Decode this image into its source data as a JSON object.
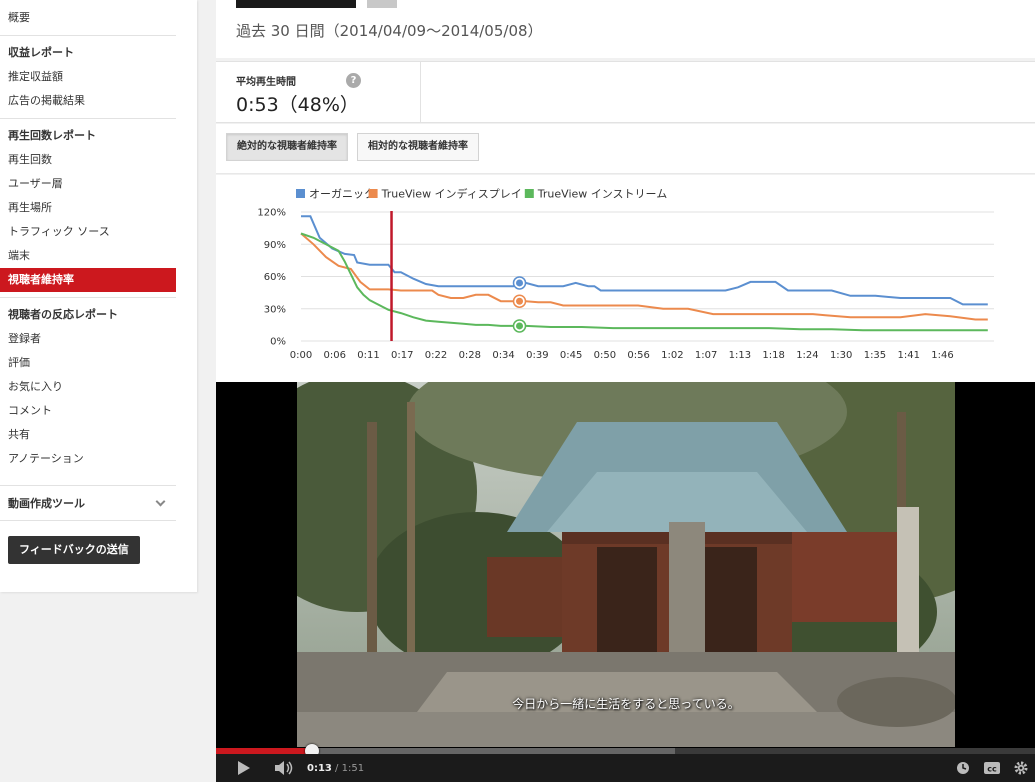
{
  "sidebar": {
    "overview": "概要",
    "revenue_header": "収益レポート",
    "revenue_items": [
      "推定収益額",
      "広告の掲載結果"
    ],
    "views_header": "再生回数レポート",
    "views_items": [
      "再生回数",
      "ユーザー層",
      "再生場所",
      "トラフィック ソース",
      "端末",
      "視聴者維持率"
    ],
    "active_item": "視聴者維持率",
    "engagement_header": "視聴者の反応レポート",
    "engagement_items": [
      "登録者",
      "評価",
      "お気に入り",
      "コメント",
      "共有",
      "アノテーション"
    ],
    "tools_label": "動画作成ツール",
    "feedback_button": "フィードバックの送信"
  },
  "header": {
    "period": "過去 30 日間（2014/04/09〜2014/05/08）"
  },
  "stat": {
    "label": "平均再生時間",
    "value": "0:53（48%）",
    "help_icon": "question-icon"
  },
  "tabs": [
    {
      "label": "絶対的な視聴者維持率",
      "selected": true
    },
    {
      "label": "相対的な視聴者維持率",
      "selected": false
    }
  ],
  "colors": {
    "accent": "#cc181e",
    "organic": "#5b8fd0",
    "display": "#ec8a4d",
    "instream": "#5cb85c"
  },
  "chart_data": {
    "type": "line",
    "ylim": [
      0,
      120
    ],
    "yticks": [
      "120%",
      "90%",
      "60%",
      "30%",
      "0%"
    ],
    "xticks": [
      "0:00",
      "0:06",
      "0:11",
      "0:17",
      "0:22",
      "0:28",
      "0:34",
      "0:39",
      "0:45",
      "0:50",
      "0:56",
      "1:02",
      "1:07",
      "1:13",
      "1:18",
      "1:24",
      "1:30",
      "1:35",
      "1:41",
      "1:46"
    ],
    "xlim": [
      0,
      111
    ],
    "grid": true,
    "legend_position": "top-left",
    "marker_time": 14.5,
    "series": [
      {
        "name": "オーガニック",
        "color": "#5b8fd0",
        "x": [
          0,
          1.5,
          3,
          5,
          7,
          8.5,
          9,
          11,
          12,
          14,
          15,
          16,
          18,
          20,
          22,
          24,
          26,
          28,
          30,
          32,
          34,
          35,
          36,
          38,
          40,
          42,
          44,
          46,
          47,
          48,
          50,
          52,
          54,
          56,
          60,
          64,
          68,
          70,
          72,
          74,
          76,
          78,
          80,
          82,
          85,
          88,
          92,
          96,
          100,
          104,
          106,
          108,
          110
        ],
        "y": [
          116,
          116,
          96,
          86,
          81,
          80,
          73,
          71,
          71,
          71,
          64,
          64,
          58,
          53,
          51,
          51,
          51,
          51,
          51,
          51,
          51,
          54,
          54,
          51,
          51,
          51,
          54,
          51,
          51,
          47,
          47,
          47,
          47,
          47,
          47,
          47,
          47,
          50,
          55,
          55,
          55,
          47,
          47,
          47,
          47,
          42,
          42,
          40,
          40,
          40,
          34,
          34,
          34
        ]
      },
      {
        "name": "TrueView インディスプレイ",
        "color": "#ec8a4d",
        "x": [
          0,
          2,
          4,
          6,
          8,
          9.5,
          11,
          13,
          14,
          16,
          18,
          20,
          21,
          22,
          24,
          26,
          28,
          30,
          32,
          34,
          36,
          38,
          40,
          42,
          44,
          46,
          48,
          50,
          52,
          54,
          58,
          62,
          66,
          70,
          74,
          78,
          82,
          84,
          88,
          92,
          96,
          100,
          104,
          108,
          110
        ],
        "y": [
          100,
          90,
          78,
          70,
          67,
          55,
          48,
          48,
          48,
          47,
          47,
          47,
          47,
          43,
          40,
          40,
          43,
          43,
          37,
          37,
          37,
          36,
          36,
          33,
          33,
          33,
          33,
          33,
          33,
          33,
          30,
          30,
          25,
          25,
          25,
          25,
          25,
          24,
          22,
          22,
          22,
          25,
          23,
          20,
          20
        ]
      },
      {
        "name": "TrueView インストリーム",
        "color": "#5cb85c",
        "x": [
          0,
          2,
          4,
          6,
          7,
          8,
          9,
          10,
          11,
          12,
          13,
          14,
          16,
          18,
          20,
          22,
          24,
          26,
          28,
          30,
          32,
          34,
          36,
          40,
          45,
          50,
          55,
          60,
          65,
          70,
          75,
          80,
          85,
          90,
          95,
          100,
          105,
          110
        ],
        "y": [
          100,
          96,
          90,
          84,
          74,
          62,
          50,
          43,
          38,
          35,
          32,
          29,
          26,
          22,
          19,
          18,
          17,
          16,
          15,
          15,
          14,
          14,
          14,
          13,
          13,
          12,
          12,
          12,
          12,
          12,
          12,
          11,
          11,
          10,
          10,
          10,
          10,
          10
        ]
      }
    ]
  },
  "player": {
    "subtitle": "今日から一緒に生活をすると思っている。",
    "time_current": "0:13",
    "time_separator": " / ",
    "time_total": "1:51",
    "played_fraction": 0.117,
    "buffered_fraction": 0.56
  }
}
